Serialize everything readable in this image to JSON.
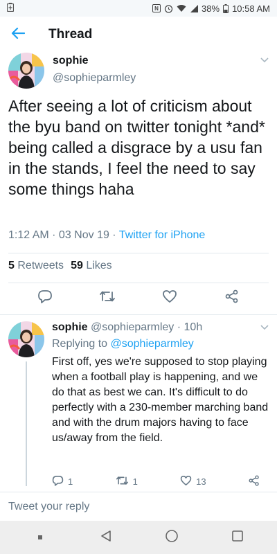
{
  "status_bar": {
    "battery": "38%",
    "time": "10:58 AM"
  },
  "header": {
    "title": "Thread"
  },
  "main_tweet": {
    "display_name": "sophie",
    "handle": "@sophieparmley",
    "text": "After seeing a lot of criticism about the byu band on twitter tonight *and* being called a disgrace by a usu fan in the stands, I feel the need to say some things haha",
    "timestamp": "1:12 AM · 03 Nov 19 · ",
    "client": "Twitter for iPhone",
    "retweets_count": "5",
    "retweets_label": "Retweets",
    "likes_count": "59",
    "likes_label": "Likes"
  },
  "reply_tweet": {
    "display_name": "sophie",
    "meta": " @sophieparmley · 10h",
    "replying_prefix": "Replying to ",
    "replying_mention": "@sophieparmley",
    "text": "First off, yes we're supposed to stop playing when a football play is happening, and we do that as best we can. It's difficult to do perfectly with a 230-member marching band and with the drum majors having to face us/away from the field.",
    "reply_count": "1",
    "retweet_count": "1",
    "like_count": "13"
  },
  "compose": {
    "placeholder": "Tweet your reply"
  },
  "colors": {
    "accent": "#1da1f2",
    "secondary_text": "#657786",
    "divider": "#e1e8ed"
  },
  "icons": [
    "back-arrow-icon",
    "chevron-down-icon",
    "reply-icon",
    "retweet-icon",
    "like-icon",
    "share-icon",
    "nav-back-icon",
    "nav-home-icon",
    "nav-recents-icon"
  ]
}
